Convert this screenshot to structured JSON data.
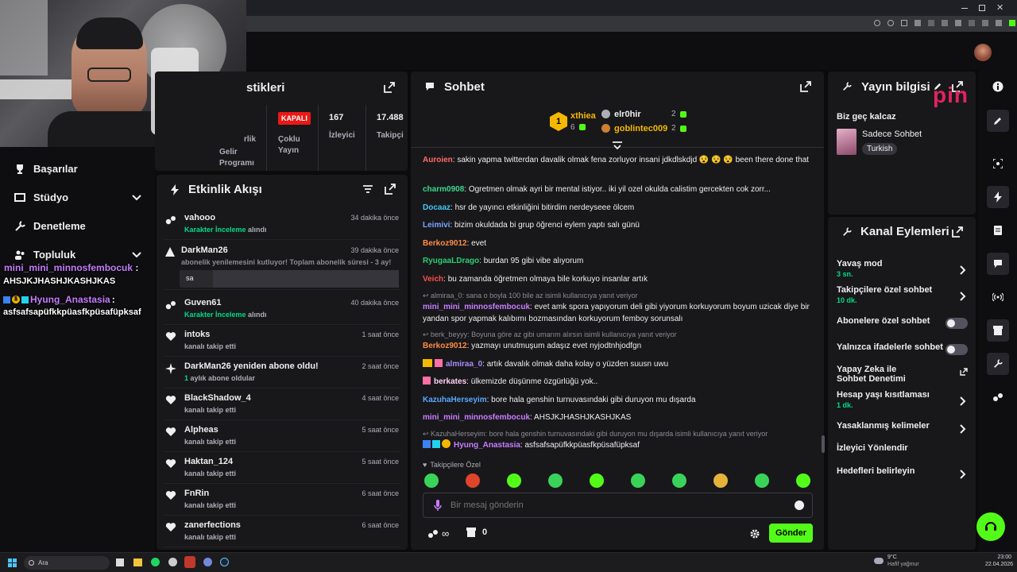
{
  "stats": {
    "partial_title": "stikleri",
    "col1_label_1": "rlik",
    "col1_label_2": "Gelir",
    "col1_label_3": "Programı",
    "status_badge": "KAPALI",
    "col2_label_1": "Çoklu",
    "col2_label_2": "Yayın",
    "viewers_value": "167",
    "viewers_label": "İzleyici",
    "followers_value": "17.488",
    "followers_label": "Takipçi"
  },
  "nav": {
    "items": [
      {
        "label": "Başarılar"
      },
      {
        "label": "Stüdyo"
      },
      {
        "label": "Denetleme"
      },
      {
        "label": "Topluluk"
      }
    ]
  },
  "overlay": {
    "line1_name": "mini_mini_minnosfembocuk",
    "line1_sep": ":",
    "line1_msg": "AHSJKJHASHJKASHJKAS",
    "line2_name": "Hyung_Anastasia",
    "line2_sep": ":",
    "line2_msg": "asfsafsapüfkkpüasfkpüsafüpksaf",
    "line2_badge": "1"
  },
  "activity": {
    "title": "Etkinlik Akışı",
    "reply_input_value": "sa",
    "items": [
      {
        "user": "vahooo",
        "sub_hl": "Karakter İnceleme",
        "sub": " alındı",
        "time": "34 dakika önce"
      },
      {
        "user": "DarkMan26",
        "sub": "abonelik yenilemesini kutluyor! Toplam abonelik süresi - 3 ay!",
        "time": "39 dakika önce"
      },
      {
        "user": "Guven61",
        "sub_hl": "Karakter İnceleme",
        "sub": " alındı",
        "time": "40 dakika önce"
      },
      {
        "user": "intoks",
        "sub": "kanalı takip etti",
        "time": "1 saat önce"
      },
      {
        "user": "DarkMan26 yeniden abone oldu!",
        "sub_hl": "1",
        "sub": " aylık abone oldular",
        "time": "2 saat önce"
      },
      {
        "user": "BlackShadow_4",
        "sub": "kanalı takip etti",
        "time": "4 saat önce"
      },
      {
        "user": "Alpheas",
        "sub": "kanalı takip etti",
        "time": "5 saat önce"
      },
      {
        "user": "Haktan_124",
        "sub": "kanalı takip etti",
        "time": "5 saat önce"
      },
      {
        "user": "FnRin",
        "sub": "kanalı takip etti",
        "time": "6 saat önce"
      },
      {
        "user": "zanerfections",
        "sub": "kanalı takip etti",
        "time": "6 saat önce"
      }
    ]
  },
  "chat": {
    "title": "Sohbet",
    "leaders": [
      {
        "rank": "1",
        "name": "xthiea",
        "count": "6"
      },
      {
        "name": "elr0hir",
        "count": "2"
      },
      {
        "name": "goblintec009",
        "count": "2"
      }
    ],
    "messages": [
      {
        "user": "Auroien",
        "color": "#ff6b6b",
        "text": "sakin yapma twitterdan davalik olmak fena zorluyor insani jdkdlskdjd 😵 😵 😵 been there done that"
      },
      {
        "user": "charm0908",
        "color": "#3dd68c",
        "text": "Ogretmen olmak ayri bir mental istiyor.. iki yil ozel okulda calistim gercekten cok zorr..."
      },
      {
        "user": "Docaaz",
        "color": "#42c6f5",
        "text": "hsr de yayıncı etkinliğini bitirdim nerdeyseee ölcem"
      },
      {
        "user": "Leimivi",
        "color": "#7aa5ff",
        "text": "bizim okuldada bi grup öğrenci eylem yaptı salı günü"
      },
      {
        "user": "Berkoz9012",
        "color": "#ff8c42",
        "text": "evet"
      },
      {
        "user": "RyugaaLDrago",
        "color": "#2ecc71",
        "text": "burdan 95 gibi vibe alıyorum"
      },
      {
        "user": "Veich",
        "color": "#ff4d4d",
        "text": "bu zamanda öğretmen olmaya bile korkuyo insanlar artık"
      },
      {
        "reply": "almiraa_0: sana o boyla 100 bile az isimli kullanıcıya yanıt veriyor",
        "user": "mini_mini_minnosfembocuk",
        "color": "#c87dff",
        "text": "evet amk spora yapıyorum deli gibi yiyorum korkuyorum boyum uzicak diye bir yandan spor yapmak kalıbımı bozmasından korkuyorum femboy sorunsalı"
      },
      {
        "reply": "berk_beyyy: Boyuna göre az gibi umarım alırsın isimli kullanıcıya yanıt veriyor",
        "user": "Berkoz9012",
        "color": "#ff8c42",
        "text": "yazmayı unutmuşum adaşız evet nyjodtnhjodfgn"
      },
      {
        "user": "almiraa_0",
        "color": "#a78bfa",
        "text": "artık davalık olmak daha kolay o yüzden suusn uwu"
      },
      {
        "user": "berkates",
        "color": "#ffd1f0",
        "text": "ülkemizde düşünme özgürlüğü yok.."
      },
      {
        "user": "KazuhaHerseyim",
        "color": "#5aa9ff",
        "text": "bore hala genshin turnuvasındaki gibi duruyon mu dışarda"
      },
      {
        "user": "mini_mini_minnosfembocuk",
        "color": "#c87dff",
        "text": "AHSJKJHASHJKASHJKAS"
      },
      {
        "reply": "KazuhaHerseyim: bore hala genshin turnuvasındaki gibi duruyon mu dışarda isimli kullanıcıya yanıt veriyor",
        "user": "Hyung_Anastasia",
        "color": "#c87dff",
        "text": "asfsafsapüfkkpüasfkpüsafüpksaf"
      }
    ],
    "followers_only_label": "Takipçilere Özel",
    "input_placeholder": "Bir mesaj gönderin",
    "points_value": "0",
    "send_label": "Gönder"
  },
  "stream_info": {
    "title_partial": "Yayın bilgisi",
    "overlay_brand": "pin",
    "stream_title": "Biz geç kalcaz",
    "category": "Sadece Sohbet",
    "language_tag": "Turkish"
  },
  "channel_actions": {
    "title": "Kanal Eylemleri",
    "items": [
      {
        "label": "Yavaş mod",
        "sub": "3 sn.",
        "kind": "chevron"
      },
      {
        "label": "Takipçilere özel sohbet",
        "sub": "10 dk.",
        "kind": "chevron"
      },
      {
        "label": "Abonelere özel sohbet",
        "kind": "toggle"
      },
      {
        "label": "Yalnızca ifadelerle sohbet",
        "kind": "toggle"
      },
      {
        "label": "Yapay Zeka ile Sohbet Denetimi",
        "kind": "external"
      },
      {
        "label": "Hesap yaşı kısıtlaması",
        "sub": "1 dk.",
        "kind": "chevron"
      },
      {
        "label": "Yasaklanmış kelimeler",
        "kind": "chevron"
      },
      {
        "label": "İzleyici Yönlendir",
        "kind": "none"
      },
      {
        "label": "Hedefleri belirleyin",
        "kind": "chevron"
      }
    ]
  },
  "taskbar": {
    "search_placeholder": "Ara",
    "weather_temp": "9°C",
    "weather_desc": "Hafif yağmur",
    "time": "23:00",
    "date": "22.04.2026"
  }
}
